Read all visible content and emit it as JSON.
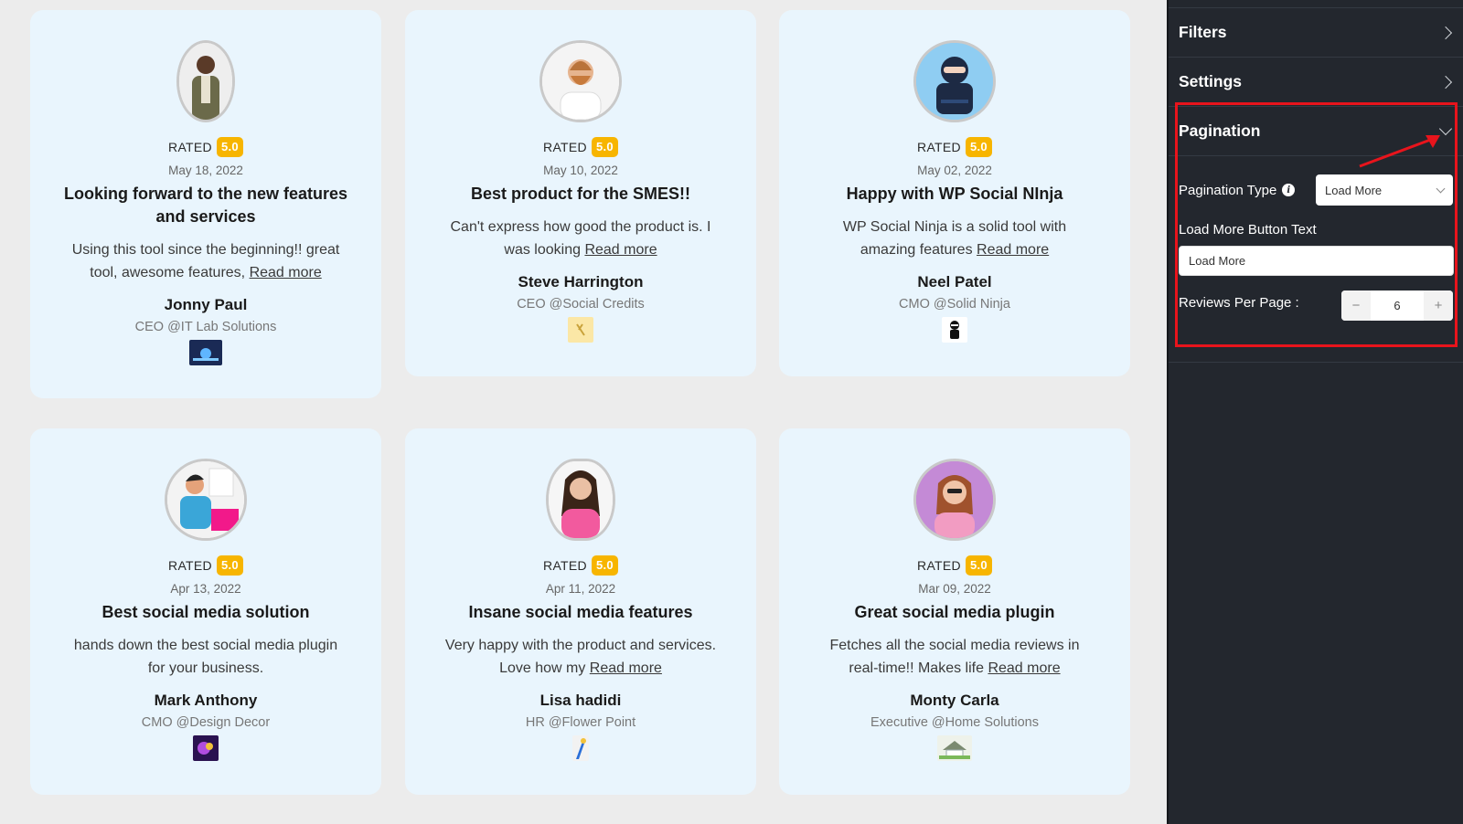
{
  "reviews": [
    {
      "rated_label": "RATED",
      "rating": "5.0",
      "date": "May 18, 2022",
      "title": "Looking forward to the new features and services",
      "text": "Using this tool since the beginning!! great tool, awesome features,",
      "read_more": "Read more",
      "name": "Jonny Paul",
      "role": "CEO @IT Lab Solutions"
    },
    {
      "rated_label": "RATED",
      "rating": "5.0",
      "date": "May 10, 2022",
      "title": "Best product for the SMES!!",
      "text": "Can't express how good the product is. I was looking",
      "read_more": "Read more",
      "name": "Steve Harrington",
      "role": "CEO @Social Credits"
    },
    {
      "rated_label": "RATED",
      "rating": "5.0",
      "date": "May 02, 2022",
      "title": "Happy with WP Social NInja",
      "text": "WP Social Ninja is a solid tool with amazing features",
      "read_more": "Read more",
      "name": "Neel Patel",
      "role": "CMO @Solid Ninja"
    },
    {
      "rated_label": "RATED",
      "rating": "5.0",
      "date": "Apr 13, 2022",
      "title": "Best social media solution",
      "text": "hands down the best social media plugin for your business.",
      "read_more": "",
      "name": "Mark Anthony",
      "role": "CMO @Design Decor"
    },
    {
      "rated_label": "RATED",
      "rating": "5.0",
      "date": "Apr 11, 2022",
      "title": "Insane social media features",
      "text": "Very happy with the product and services. Love how my",
      "read_more": "Read more",
      "name": "Lisa hadidi",
      "role": "HR @Flower Point"
    },
    {
      "rated_label": "RATED",
      "rating": "5.0",
      "date": "Mar 09, 2022",
      "title": "Great social media plugin",
      "text": "Fetches all the social media reviews in real-time!! Makes life",
      "read_more": "Read more",
      "name": "Monty Carla",
      "role": "Executive @Home Solutions"
    }
  ],
  "sidebar": {
    "filters_label": "Filters",
    "settings_label": "Settings",
    "pagination_label": "Pagination",
    "pagination_type_label": "Pagination Type",
    "pagination_type_value": "Load More",
    "load_more_text_label": "Load More Button Text",
    "load_more_text_value": "Load More",
    "reviews_per_page_label": "Reviews Per Page :",
    "reviews_per_page_value": "6",
    "minus": "−",
    "plus": "+"
  },
  "colors": {
    "card_bg": "#e9f5fd",
    "rating_badge": "#f7b500",
    "sidebar_bg": "#23272e",
    "highlight": "#e8141c"
  }
}
